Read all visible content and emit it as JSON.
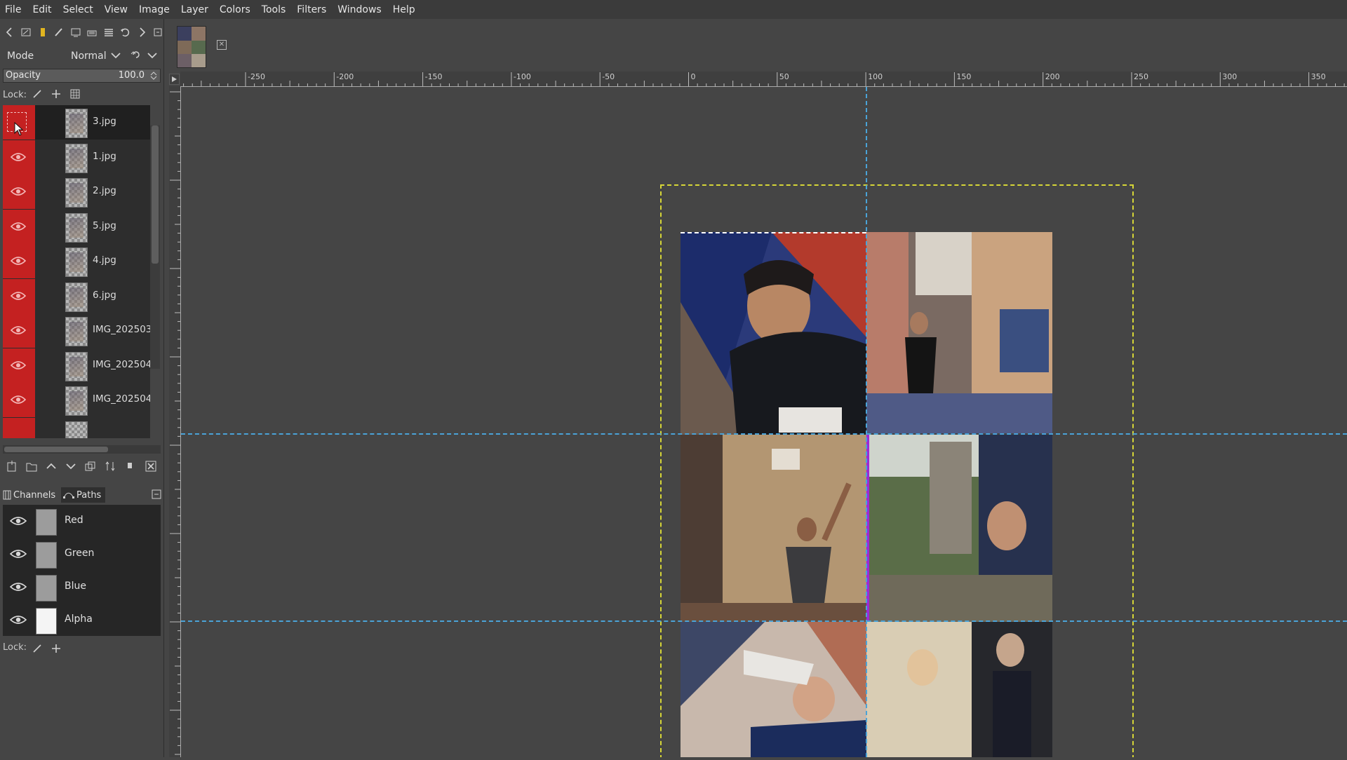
{
  "menu": [
    "File",
    "Edit",
    "Select",
    "View",
    "Image",
    "Layer",
    "Colors",
    "Tools",
    "Filters",
    "Windows",
    "Help"
  ],
  "layers_dock": {
    "mode_label": "Mode",
    "mode_value": "Normal",
    "opacity_label": "Opacity",
    "opacity_value": "100.0",
    "lock_label": "Lock:",
    "layers": [
      {
        "name": "3.jpg",
        "visible": false,
        "selected": true
      },
      {
        "name": "1.jpg",
        "visible": true
      },
      {
        "name": "2.jpg",
        "visible": true
      },
      {
        "name": "5.jpg",
        "visible": true
      },
      {
        "name": "4.jpg",
        "visible": true
      },
      {
        "name": "6.jpg",
        "visible": true
      },
      {
        "name": "IMG_202503",
        "visible": true
      },
      {
        "name": "IMG_202504",
        "visible": true
      },
      {
        "name": "IMG_202504",
        "visible": true
      }
    ]
  },
  "channels_dock": {
    "tab_channels": "Channels",
    "tab_paths": "Paths",
    "channels": [
      {
        "name": "Red"
      },
      {
        "name": "Green"
      },
      {
        "name": "Blue"
      },
      {
        "name": "Alpha"
      }
    ],
    "lock_label": "Lock:"
  },
  "ruler": {
    "h_ticks": [
      "-250",
      "-200",
      "-150",
      "-100",
      "-50",
      "0",
      "50",
      "100",
      "150",
      "200",
      "250",
      "300",
      "350"
    ]
  },
  "colors": {
    "accent_red": "#c42121",
    "guide": "#4aa3d8",
    "canvas_boundary": "#d6d637"
  }
}
